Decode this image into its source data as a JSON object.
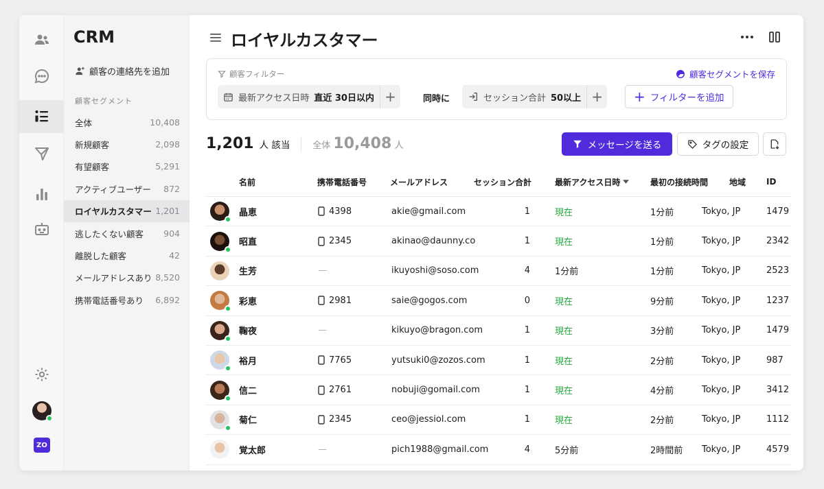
{
  "app": {
    "brand": "CRM",
    "logo_text": "ZO",
    "rail_icons": [
      "users-icon",
      "chat-icon",
      "list-icon",
      "send-icon",
      "analytics-icon",
      "bot-icon",
      "gear-icon"
    ]
  },
  "sidebar": {
    "add_contact_label": "顧客の連絡先を追加",
    "segments_heading": "顧客セグメント",
    "items": [
      {
        "label": "全体",
        "count": "10,408"
      },
      {
        "label": "新規顧客",
        "count": "2,098"
      },
      {
        "label": "有望顧客",
        "count": "5,291"
      },
      {
        "label": "アクティブユーザー",
        "count": "872"
      },
      {
        "label": "ロイヤルカスタマー",
        "count": "1,201"
      },
      {
        "label": "逃したくない顧客",
        "count": "904"
      },
      {
        "label": "離脱した顧客",
        "count": "42"
      },
      {
        "label": "メールアドレスあり",
        "count": "8,520"
      },
      {
        "label": "携帯電話番号あり",
        "count": "6,892"
      }
    ],
    "active_index": 4
  },
  "header": {
    "title": "ロイヤルカスタマー"
  },
  "filters": {
    "label": "顧客フィルター",
    "save_segment_label": "顧客セグメントを保存",
    "chip1": {
      "field": "最新アクセス日時",
      "value": "直近 30日以内"
    },
    "and_label": "同時に",
    "chip2": {
      "field": "セッション合計",
      "value": "50以上"
    },
    "plus_label": "+",
    "add_filter_label": "フィルターを追加"
  },
  "summary": {
    "count": "1,201",
    "count_unit": "人 該当",
    "total_label": "全体",
    "total": "10,408",
    "total_unit": "人"
  },
  "actions": {
    "send_message_label": "メッセージを送る",
    "tag_label": "タグの設定"
  },
  "table": {
    "columns": {
      "name": "名前",
      "phone": "携帯電話番号",
      "email": "メールアドレス",
      "sessions": "セッション合計",
      "last_access": "最新アクセス日時",
      "first_connect": "最初の接続時間",
      "region": "地域",
      "id": "ID"
    },
    "rows": [
      {
        "name": "晶恵",
        "phone": "4398",
        "email": "akie@gmail.com",
        "sessions": "1",
        "last_access": "現在",
        "first_connect": "1分前",
        "region": "Tokyo, JP",
        "id": "1479",
        "online": true,
        "skin": "#c9916b",
        "hair": "#2a1c17"
      },
      {
        "name": "昭直",
        "phone": "2345",
        "email": "akinao@daunny.co",
        "sessions": "1",
        "last_access": "現在",
        "first_connect": "1分前",
        "region": "Tokyo, JP",
        "id": "2342",
        "online": true,
        "skin": "#7a4e33",
        "hair": "#1b1210"
      },
      {
        "name": "生芳",
        "phone": "—",
        "email": "ikuyoshi@soso.com",
        "sessions": "4",
        "last_access": "1分前",
        "first_connect": "1分前",
        "region": "Tokyo, JP",
        "id": "2523",
        "online": false,
        "skin": "#5a3a28",
        "hair": "#e9d2b8"
      },
      {
        "name": "彩恵",
        "phone": "2981",
        "email": "saie@gogos.com",
        "sessions": "0",
        "last_access": "現在",
        "first_connect": "9分前",
        "region": "Tokyo, JP",
        "id": "1237",
        "online": true,
        "skin": "#e2b899",
        "hair": "#c37a44"
      },
      {
        "name": "鞠夜",
        "phone": "—",
        "email": "kikuyo@bragon.com",
        "sessions": "1",
        "last_access": "現在",
        "first_connect": "3分前",
        "region": "Tokyo, JP",
        "id": "1479",
        "online": true,
        "skin": "#d9a98a",
        "hair": "#3a241b"
      },
      {
        "name": "裕月",
        "phone": "7765",
        "email": "yutsuki0@zozos.com",
        "sessions": "1",
        "last_access": "現在",
        "first_connect": "2分前",
        "region": "Tokyo, JP",
        "id": "987",
        "online": true,
        "skin": "#e8c7a8",
        "hair": "#cfd8e6"
      },
      {
        "name": "信二",
        "phone": "2761",
        "email": "nobuji@gomail.com",
        "sessions": "1",
        "last_access": "現在",
        "first_connect": "4分前",
        "region": "Tokyo, JP",
        "id": "3412",
        "online": true,
        "skin": "#b67c57",
        "hair": "#3b2618"
      },
      {
        "name": "菊仁",
        "phone": "2345",
        "email": "ceo@jessiol.com",
        "sessions": "1",
        "last_access": "現在",
        "first_connect": "2分前",
        "region": "Tokyo, JP",
        "id": "1112",
        "online": true,
        "skin": "#d8b49a",
        "hair": "#e1e1e3"
      },
      {
        "name": "覚太郎",
        "phone": "—",
        "email": "pich1988@gmail.com",
        "sessions": "4",
        "last_access": "5分前",
        "first_connect": "2時間前",
        "region": "Tokyo, JP",
        "id": "4579",
        "online": false,
        "skin": "#e8c3a6",
        "hair": "#f2f2f2"
      }
    ]
  },
  "colors": {
    "accent": "#4f2bdc",
    "online": "#22c55e",
    "now_text": "#22a83a"
  }
}
